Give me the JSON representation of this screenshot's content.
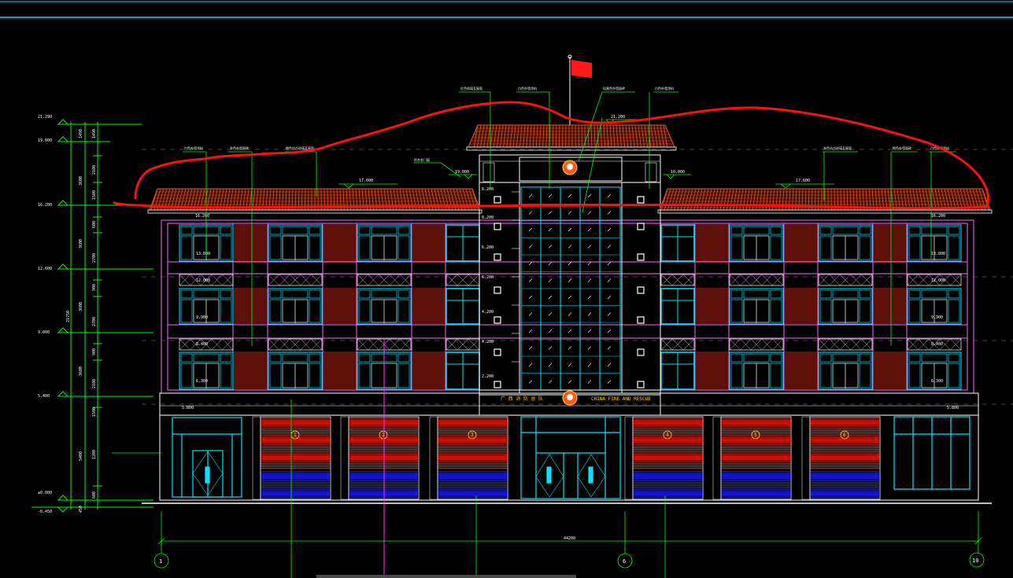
{
  "drawing": {
    "left_elevations": [
      "21.290",
      "19.800",
      "16.200",
      "12.600",
      "9.000",
      "5.400",
      "±0.000",
      "-0.450"
    ],
    "left_dims_inner": [
      "1490",
      "3600",
      "3600",
      "3600",
      "3600",
      "5400",
      "450"
    ],
    "left_dims_total": "21750",
    "left_dims_fine": [
      "1490",
      "2100",
      "1500",
      "600",
      "2700",
      "900",
      "2700",
      "900",
      "2100",
      "1500",
      "1200",
      "600"
    ],
    "facade_levels": [
      "16.200",
      "13.800",
      "12.000",
      "9.900",
      "8.400",
      "6.300",
      "5.800",
      "5.800"
    ],
    "roof_levels": [
      "17.600",
      "17.600",
      "19.000",
      "18.000",
      "21.200"
    ],
    "tower_levels": [
      "8.200",
      "8.200",
      "6.200",
      "6.200",
      "4.200",
      "4.200",
      "2.200"
    ],
    "notes": [
      "白色外墙涂料",
      "灰色外墙面砖",
      "橙色仿古琉璃瓦屋面",
      "红色琉璃瓦屋面",
      "白色外墙涂料",
      "桔黄色外墙面砖",
      "灰色仿古琉璃瓦屋面",
      "橙色外墙面砖",
      "白色外墙涂料",
      "铝合金门窗",
      "白色外墙涂料"
    ],
    "sign_cn": "广 西 消 防 总 队",
    "sign_en": "CHINA  FIRE  AND  RESCUE",
    "door_numbers": [
      "1",
      "2",
      "3",
      "4",
      "5",
      "6"
    ],
    "axis_labels": [
      "1",
      "6",
      "10"
    ],
    "overall_width": "44200",
    "colors": {
      "background": "#000000",
      "roof_tile": "#e8551c",
      "window_frame": "#00e5ff",
      "wall_outline": "#ff66ff",
      "dimension": "#00ff00",
      "annotation_mark": "#ff1a1a",
      "shutter_red": "#ff2a1a",
      "shutter_blue": "#2b2bff",
      "sign_text": "#ffd400"
    }
  }
}
